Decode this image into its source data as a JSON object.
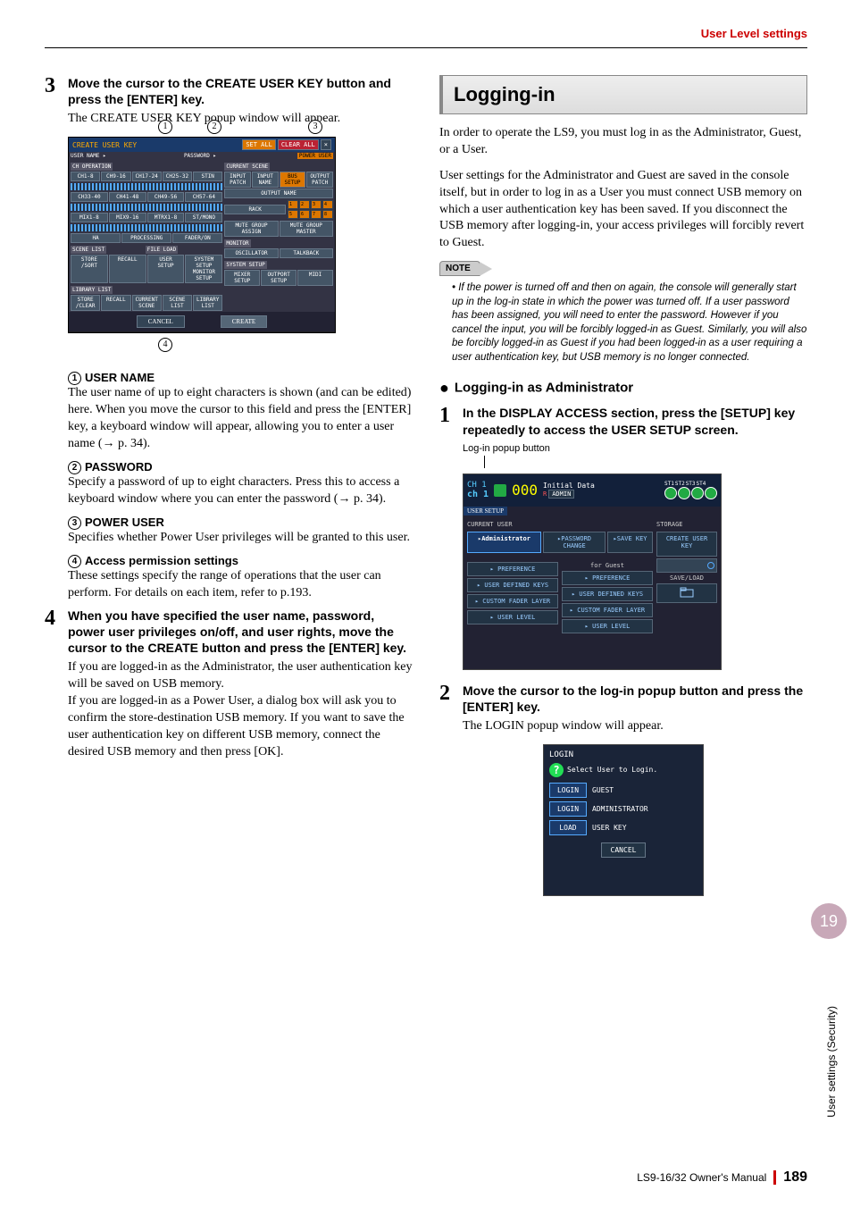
{
  "header": {
    "section": "User Level settings"
  },
  "left": {
    "step3": {
      "num": "3",
      "title": "Move the cursor to the CREATE USER KEY button and press the [ENTER] key.",
      "body": "The CREATE USER KEY popup window will appear."
    },
    "figure1": {
      "callout1": "1",
      "callout2": "2",
      "callout3": "3",
      "callout4": "4",
      "title": "CREATE USER KEY",
      "user_name_label": "USER NAME",
      "password_label": "PASSWORD",
      "set_all": "SET ALL",
      "clear_all": "CLEAR ALL",
      "power_user": "POWER USER",
      "ch_op": "CH OPERATION",
      "ch_tabs": [
        "CH1-8",
        "CH9-16",
        "CH17-24",
        "CH25-32",
        "STIN"
      ],
      "ch_tabs2": [
        "CH33-40",
        "CH41-48",
        "CH49-56",
        "CH57-64"
      ],
      "mix_tabs": [
        "MIX1-8",
        "MIX9-16",
        "MTRX1-8",
        "ST/MONO"
      ],
      "bottom_tabs": [
        "HA",
        "PROCESSING",
        "FADER/ON"
      ],
      "current_scene": "CURRENT SCENE",
      "patches": [
        "INPUT PATCH",
        "INPUT NAME",
        "BUS SETUP",
        "OUTPUT PATCH",
        "OUTPUT NAME"
      ],
      "rack": "RACK",
      "rack_nums": [
        "1",
        "2",
        "3",
        "4",
        "5",
        "6",
        "7",
        "8"
      ],
      "mute_assign": "MUTE GROUP ASSIGN",
      "mute_master": "MUTE GROUP MASTER",
      "scene_list": "SCENE LIST",
      "file_load": "FILE LOAD",
      "monitor": "MONITOR",
      "scene_btns": [
        "STORE /SORT",
        "RECALL"
      ],
      "file_btns": [
        "USER SETUP",
        "SYSTEM SETUP MONITOR SETUP"
      ],
      "monitor_btns": [
        "OSCILLATOR",
        "TALKBACK"
      ],
      "lib_list": "LIBRARY LIST",
      "system_setup": "SYSTEM SETUP",
      "lib_btns": [
        "STORE /CLEAR",
        "RECALL"
      ],
      "lib2_btns": [
        "CURRENT SCENE",
        "SCENE LIST",
        "LIBRARY LIST"
      ],
      "sys_btns": [
        "MIXER SETUP",
        "OUTPORT SETUP",
        "MIDI"
      ],
      "cancel": "CANCEL",
      "create": "CREATE"
    },
    "defs": {
      "d1": {
        "n": "1",
        "title": "USER NAME",
        "body": "The user name of up to eight characters is shown (and can be edited) here. When you move the cursor to this field and press the [ENTER] key, a keyboard window will appear, allowing you to enter a user name (→ p. 34)."
      },
      "d2": {
        "n": "2",
        "title": "PASSWORD",
        "body": "Specify a password of up to eight characters. Press this to access a keyboard window where you can enter the password (→ p. 34)."
      },
      "d3": {
        "n": "3",
        "title": "POWER USER",
        "body": "Specifies whether Power User privileges will be granted to this user."
      },
      "d4": {
        "n": "4",
        "title": "Access permission settings",
        "body": "These settings specify the range of operations that the user can perform. For details on each item, refer to p.193."
      }
    },
    "step4": {
      "num": "4",
      "title": "When you have specified the user name, password, power user privileges on/off, and user rights, move the cursor to the CREATE button and press the [ENTER] key.",
      "body": "If you are logged-in as the Administrator, the user authentication key will be saved on USB memory.\nIf you are logged-in as a Power User, a dialog box will ask you to confirm the store-destination USB memory. If you want to save the user authentication key on different USB memory, connect the desired USB memory and then press [OK]."
    }
  },
  "right": {
    "section_title": "Logging-in",
    "para1": "In order to operate the LS9, you must log in as the Administrator, Guest, or a User.",
    "para2": "User settings for the Administrator and Guest are saved in the console itself, but in order to log in as a User you must connect USB memory on which a user authentication key has been saved. If you disconnect the USB memory after logging-in, your access privileges will forcibly revert to Guest.",
    "note_label": "NOTE",
    "note_body": "• If the power is turned off and then on again, the console will generally start up in the log-in state in which the power was turned off. If a user password has been assigned, you will need to enter the password. However if you cancel the input, you will be forcibly logged-in as Guest. Similarly, you will also be forcibly logged-in as Guest if you had been logged-in as a user requiring a user authentication key, but USB memory is no longer connected.",
    "subheading": "Logging-in as Administrator",
    "step1": {
      "num": "1",
      "title": "In the DISPLAY ACCESS section, press the [SETUP] key repeatedly to access the USER SETUP screen."
    },
    "ss_label": "Log-in popup button",
    "screenshot2": {
      "ch_label": "CH  1",
      "ch_name": "ch  1",
      "seg": "000",
      "initial": "Initial Data",
      "r_icon": "R",
      "admin": "ADMIN",
      "st_tabs": [
        "ST1",
        "ST2",
        "ST3",
        "ST4"
      ],
      "tab": "USER SETUP",
      "current_user": "CURRENT USER",
      "storage": "STORAGE",
      "admin_btn": "Administrator",
      "pw_change": "PASSWORD CHANGE",
      "save_key": "SAVE KEY",
      "create_key": "CREATE USER KEY",
      "for_guest": "for Guest",
      "left_btns": [
        "PREFERENCE",
        "USER DEFINED KEYS",
        "CUSTOM FADER LAYER",
        "USER LEVEL"
      ],
      "right_btns": [
        "PREFERENCE",
        "USER DEFINED KEYS",
        "CUSTOM FADER LAYER",
        "USER LEVEL"
      ],
      "save_load": "SAVE/LOAD"
    },
    "step2": {
      "num": "2",
      "title": "Move the cursor to the log-in popup button and press the [ENTER] key.",
      "body": "The LOGIN popup window will appear."
    },
    "login": {
      "title": "LOGIN",
      "msg": "Select User to Login.",
      "rows": [
        {
          "btn": "LOGIN",
          "label": "GUEST"
        },
        {
          "btn": "LOGIN",
          "label": "ADMINISTRATOR"
        },
        {
          "btn": "LOAD",
          "label": "USER KEY"
        }
      ],
      "cancel": "CANCEL"
    }
  },
  "footer": {
    "doc": "LS9-16/32  Owner's Manual",
    "page": "189"
  },
  "sidebar": {
    "chapter": "19",
    "label": "User settings (Security)"
  }
}
